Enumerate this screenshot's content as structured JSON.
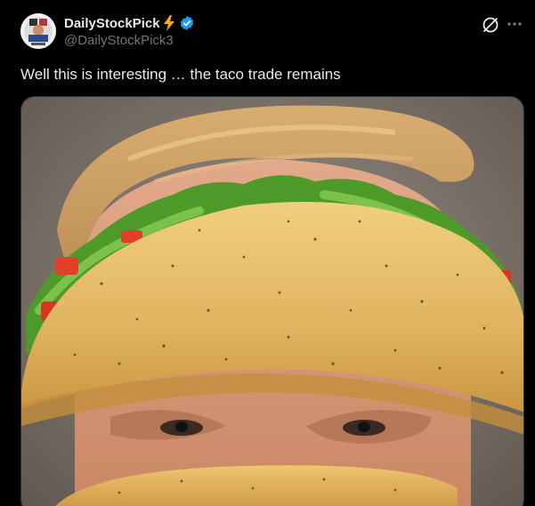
{
  "author": {
    "display_name": "DailyStockPick",
    "handle": "@DailyStockPick3",
    "avatar_icon": "avatar-badge",
    "badge_icons": [
      "lightning-bolt-icon",
      "verified-badge-icon"
    ]
  },
  "actions": {
    "grok_icon": "grok-icon",
    "more_icon": "more-options-icon"
  },
  "post": {
    "text": "Well this is interesting … the taco trade remains"
  },
  "colors": {
    "background": "#000000",
    "text_primary": "#e7e9ea",
    "text_secondary": "#71767b",
    "verified": "#1d9bf0",
    "bolt": "#f5a623"
  }
}
